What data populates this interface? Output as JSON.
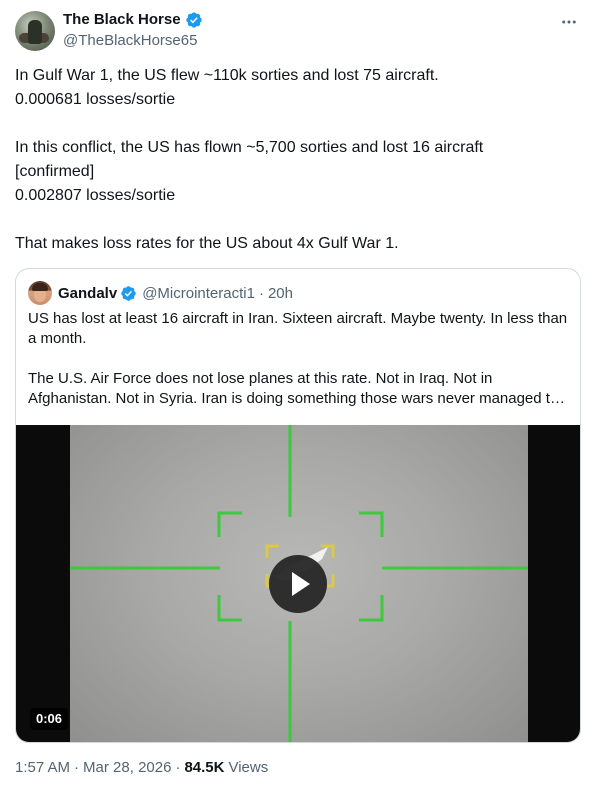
{
  "author": {
    "name": "The Black Horse",
    "handle": "@TheBlackHorse65"
  },
  "tweet": {
    "lines": [
      "In Gulf War 1, the US flew ~110k sorties and lost 75 aircraft.",
      "0.000681 losses/sortie",
      "In this conflict, the US has flown ~5,700 sorties and lost 16 aircraft",
      "[confirmed]",
      "0.002807 losses/sortie",
      "That makes loss rates for the US about 4x Gulf War 1."
    ]
  },
  "quote": {
    "name": "Gandalv",
    "handle": "@Microinteracti1",
    "separator": "·",
    "time": "20h",
    "text_1": "US has lost at least 16 aircraft in Iran. Sixteen aircraft. Maybe twenty. In less than a month.",
    "text_2_line_1": "The U.S. Air Force does not lose planes at this rate. Not in Iraq. Not in",
    "text_2_line_2": "Afghanistan. Not in Syria. Iran is doing something those wars never managed t…",
    "video": {
      "duration": "0:06"
    }
  },
  "footer": {
    "time": "1:57 AM",
    "separator": "·",
    "date": "Mar 28, 2026",
    "views_count": "84.5K",
    "views_label": "Views"
  },
  "colors": {
    "verified": "#1d9bf0",
    "text_primary": "#0f1419",
    "text_secondary": "#536471",
    "border": "#cfd9de",
    "reticle": "#33cc33"
  }
}
